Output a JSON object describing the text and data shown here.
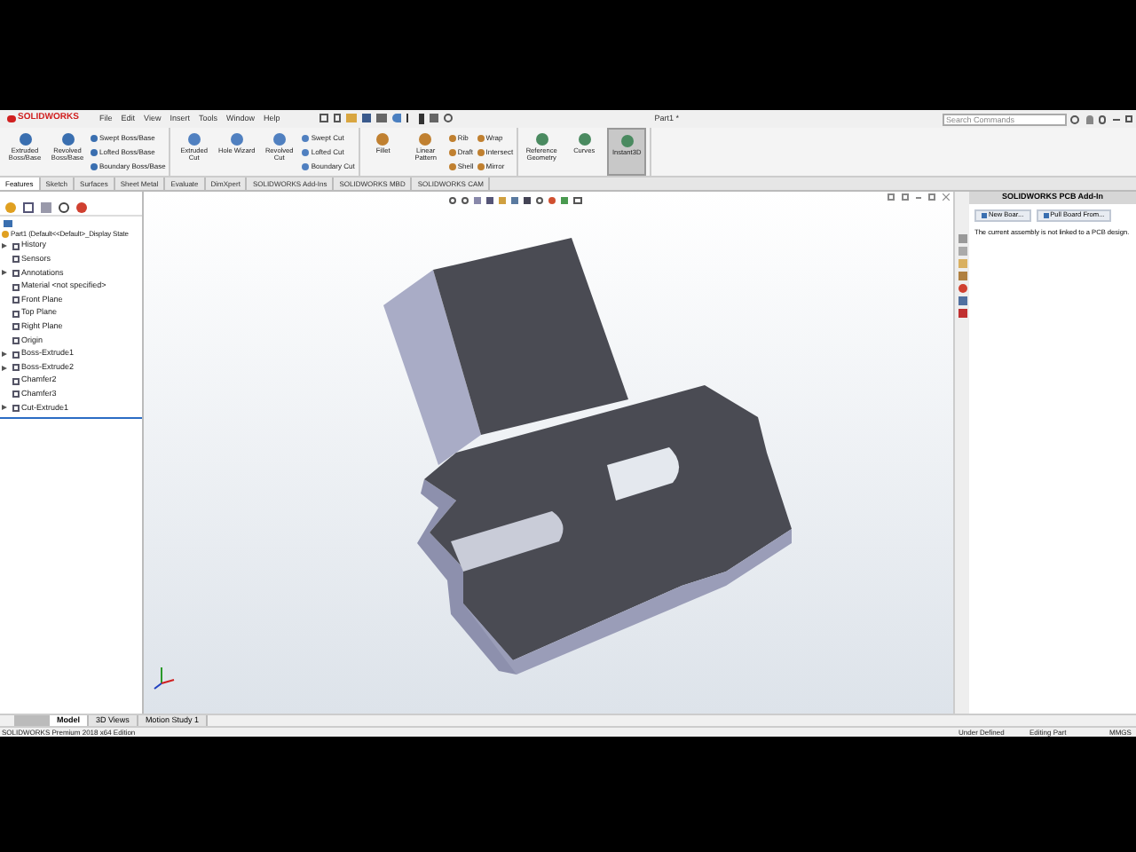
{
  "title_bar": {
    "logo": "SOLIDWORKS",
    "menus": [
      "File",
      "Edit",
      "View",
      "Insert",
      "Tools",
      "Window",
      "Help"
    ],
    "document_title": "Part1 *",
    "search": {
      "placeholder": "Search Commands"
    }
  },
  "command_manager": {
    "groups": [
      {
        "columns": [
          [
            {
              "label": "Extruded Boss/Base",
              "on": false
            }
          ],
          [
            {
              "label": "Revolved Boss/Base",
              "on": false
            }
          ],
          [
            {
              "label": "Swept Boss/Base",
              "on": false
            },
            {
              "label": "Lofted Boss/Base",
              "on": false
            },
            {
              "label": "Boundary Boss/Base",
              "on": false
            }
          ]
        ]
      },
      {
        "columns": [
          [
            {
              "label": "Extruded Cut",
              "on": false
            }
          ],
          [
            {
              "label": "Hole Wizard",
              "on": false
            }
          ],
          [
            {
              "label": "Revolved Cut",
              "on": false
            }
          ],
          [
            {
              "label": "Swept Cut",
              "on": false
            },
            {
              "label": "Lofted Cut",
              "on": false
            },
            {
              "label": "Boundary Cut",
              "on": false
            }
          ]
        ]
      },
      {
        "columns": [
          [
            {
              "label": "Fillet",
              "on": false
            }
          ],
          [
            {
              "label": "Linear Pattern",
              "on": false
            }
          ],
          [
            {
              "label": "Rib",
              "on": false
            },
            {
              "label": "Draft",
              "on": false
            },
            {
              "label": "Shell",
              "on": false
            }
          ],
          [
            {
              "label": "Wrap",
              "on": false
            },
            {
              "label": "Intersect",
              "on": false
            },
            {
              "label": "Mirror",
              "on": false
            }
          ]
        ]
      },
      {
        "columns": [
          [
            {
              "label": "Reference Geometry",
              "on": false
            }
          ],
          [
            {
              "label": "Curves",
              "on": false
            }
          ],
          [
            {
              "label": "Instant3D",
              "on": true
            }
          ]
        ]
      }
    ]
  },
  "tabs": [
    {
      "label": "Features",
      "selected": true
    },
    {
      "label": "Sketch",
      "selected": false
    },
    {
      "label": "Surfaces",
      "selected": false
    },
    {
      "label": "Sheet Metal",
      "selected": false
    },
    {
      "label": "Evaluate",
      "selected": false
    },
    {
      "label": "DimXpert",
      "selected": false
    },
    {
      "label": "SOLIDWORKS Add-Ins",
      "selected": false
    },
    {
      "label": "SOLIDWORKS MBD",
      "selected": false
    },
    {
      "label": "SOLIDWORKS CAM",
      "selected": false
    }
  ],
  "feature_tree": {
    "root": "Part1  (Default<<Default>_Display State",
    "items": [
      {
        "label": "History",
        "collapsed": true
      },
      {
        "label": "Sensors",
        "collapsed": false
      },
      {
        "label": "Annotations",
        "collapsed": true
      },
      {
        "label": "Material <not specified>",
        "collapsed": false
      },
      {
        "label": "Front Plane",
        "collapsed": false
      },
      {
        "label": "Top Plane",
        "collapsed": false
      },
      {
        "label": "Right Plane",
        "collapsed": false
      },
      {
        "label": "Origin",
        "collapsed": false
      },
      {
        "label": "Boss-Extrude1",
        "collapsed": true
      },
      {
        "label": "Boss-Extrude2",
        "collapsed": true
      },
      {
        "label": "Chamfer2",
        "collapsed": false
      },
      {
        "label": "Chamfer3",
        "collapsed": false
      },
      {
        "label": "Cut-Extrude1",
        "collapsed": true
      }
    ]
  },
  "task_pane": {
    "title": "SOLIDWORKS PCB Add-In",
    "buttons": [
      "New Boar...",
      "Pull Board From..."
    ],
    "message": "The current assembly is not linked to a PCB design."
  },
  "bottom_tabs": [
    {
      "label": "Model",
      "selected": true
    },
    {
      "label": "3D Views",
      "selected": false
    },
    {
      "label": "Motion Study 1",
      "selected": false
    }
  ],
  "status_bar": {
    "product": "SOLIDWORKS Premium 2018 x64 Edition",
    "state": "Under Defined",
    "mode": "Editing Part",
    "units": "MMGS"
  }
}
